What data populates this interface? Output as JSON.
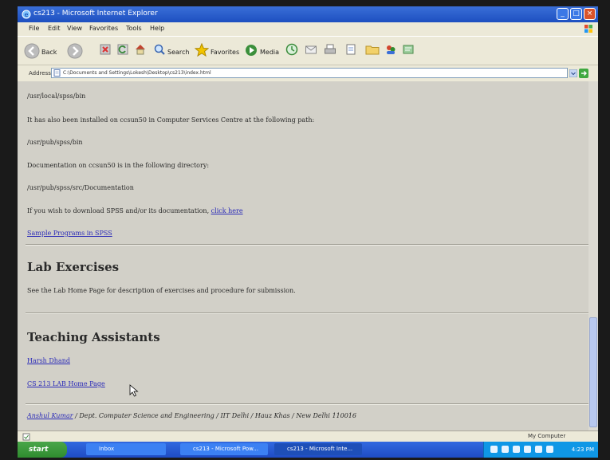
{
  "window": {
    "title": "cs213 - Microsoft Internet Explorer",
    "min_glyph": "_",
    "max_glyph": "□",
    "close_glyph": "×"
  },
  "menu": [
    "File",
    "Edit",
    "View",
    "Favorites",
    "Tools",
    "Help"
  ],
  "toolbar": {
    "back": "Back",
    "search": "Search",
    "favorites": "Favorites",
    "media": "Media"
  },
  "address": {
    "label": "Address",
    "value": "C:\\Documents and Settings\\Lokesh\\Desktop\\cs213\\index.html"
  },
  "content": {
    "path1": "/usr/local/spss/bin",
    "installed_text": "It has also been installed on ccsun50 in Computer Services Centre at the following path:",
    "path2": "/usr/pub/spss/bin",
    "doc_text": "Documentation on ccsun50 is in the following directory:",
    "path3": "/usr/pub/spss/src/Documentation",
    "download_text": "If you wish to download SPSS and/or its documentation,",
    "click_here": "click here",
    "sample_programs": "Sample Programs in SPSS",
    "lab_heading": "Lab Exercises",
    "lab_text": "See the Lab Home Page for description of exercises and procedure for submission.",
    "ta_heading": "Teaching Assistants",
    "ta_link": "Harsh Dhand",
    "lab_home": "CS 213 LAB Home Page",
    "footer_link": "Anshul Kumar",
    "footer_text": " / Dept. Computer Science and Engineering / IIT Delhi / Hauz Khas / New Delhi 110016"
  },
  "status": {
    "zone": "My Computer"
  },
  "taskbar": {
    "start": "start",
    "tasks": [
      "Inbox",
      "cs213 - Microsoft Pow...",
      "cs213 - Microsoft Inte..."
    ],
    "clock": "4:23 PM"
  },
  "colors": {
    "link": "#2a2ab8",
    "titlebar": "#1d4fc0"
  }
}
